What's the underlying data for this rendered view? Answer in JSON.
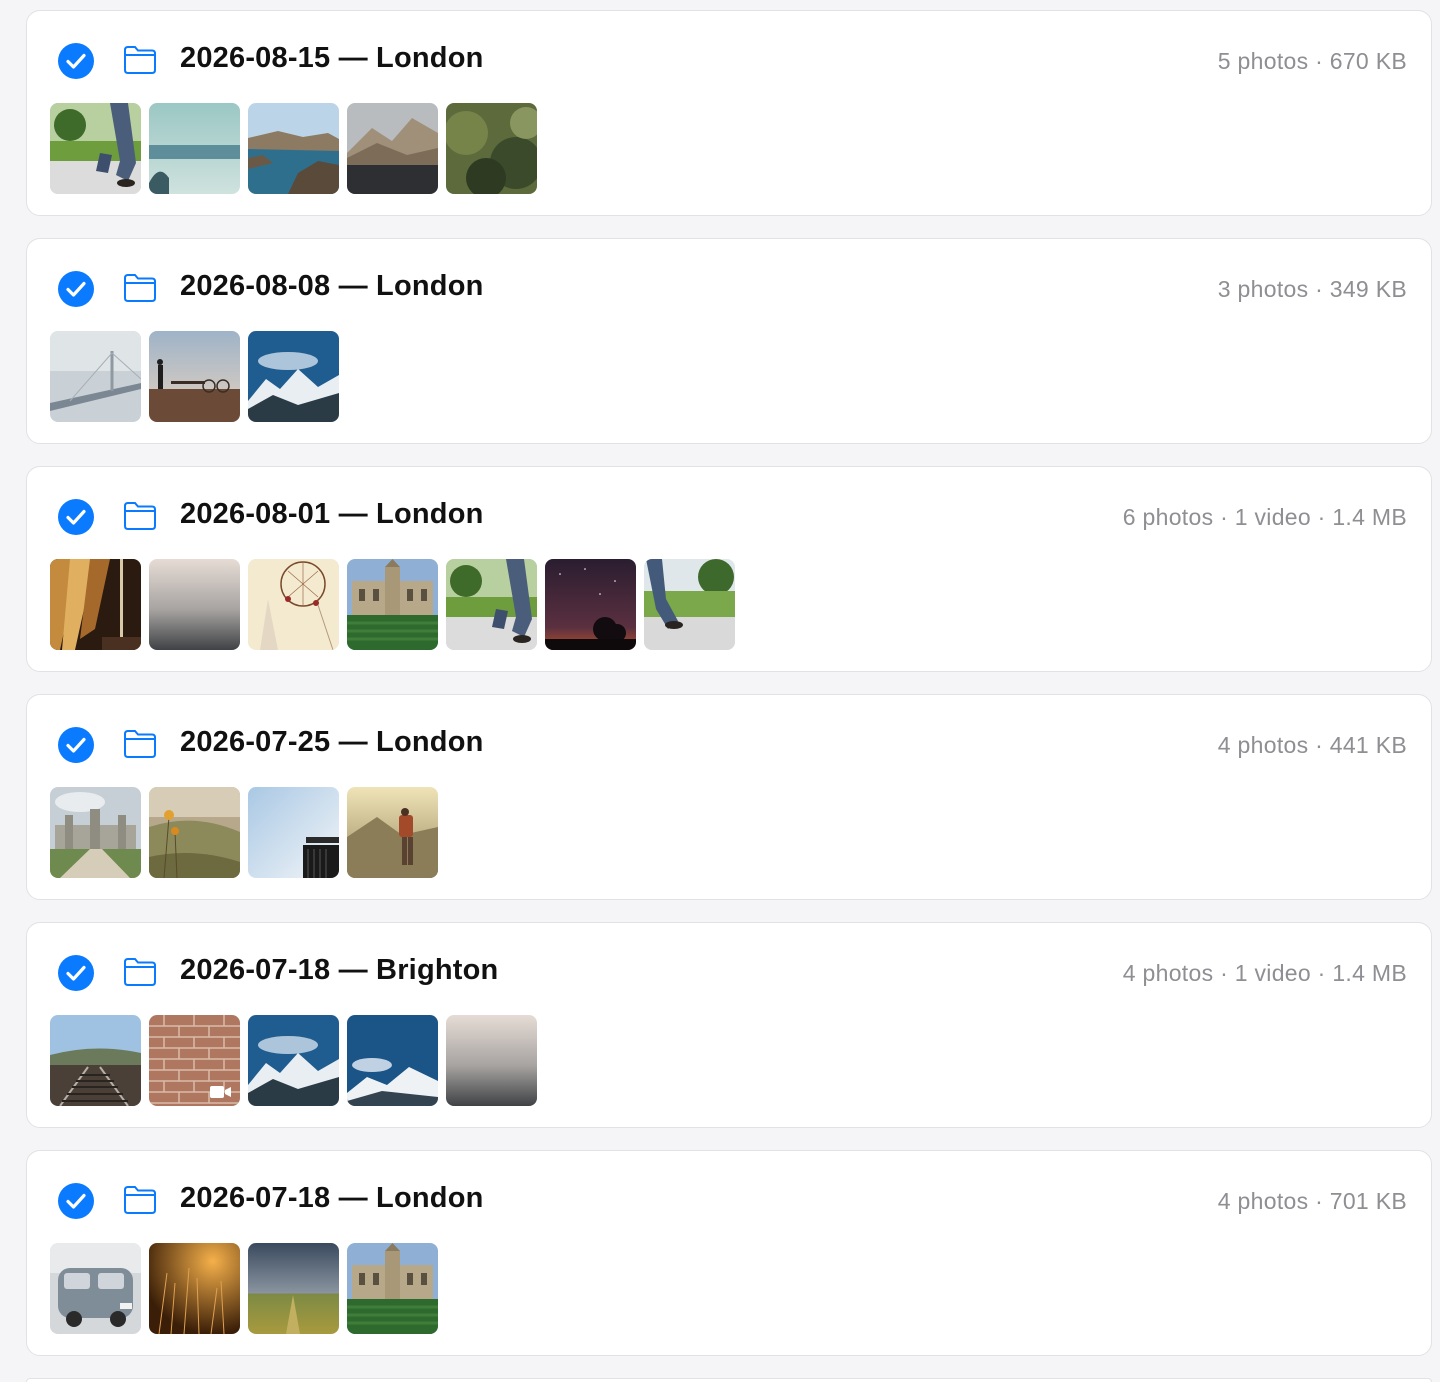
{
  "accent_color": "#0a7aff",
  "folders": [
    {
      "title": "2026-08-15 — London",
      "meta": "5 photos · 670 KB",
      "selected": true,
      "thumbnails": [
        {
          "scene": "park-legs"
        },
        {
          "scene": "teal-ocean"
        },
        {
          "scene": "rocky-coast"
        },
        {
          "scene": "mountain-lake"
        },
        {
          "scene": "dark-forest"
        }
      ]
    },
    {
      "title": "2026-08-08 — London",
      "meta": "3 photos · 349 KB",
      "selected": true,
      "thumbnails": [
        {
          "scene": "foggy-bridge"
        },
        {
          "scene": "person-bicycle-shore"
        },
        {
          "scene": "snowy-mountains"
        }
      ]
    },
    {
      "title": "2026-08-01 — London",
      "meta": "6 photos · 1 video · 1.4 MB",
      "selected": true,
      "thumbnails": [
        {
          "scene": "golden-curtains"
        },
        {
          "scene": "misty-sea"
        },
        {
          "scene": "dreamcatcher"
        },
        {
          "scene": "college-lawn"
        },
        {
          "scene": "park-legs"
        },
        {
          "scene": "night-sky-tree"
        },
        {
          "scene": "park-legs-alt"
        }
      ]
    },
    {
      "title": "2026-07-25 — London",
      "meta": "4 photos · 441 KB",
      "selected": true,
      "thumbnails": [
        {
          "scene": "castle-path"
        },
        {
          "scene": "flowers-valley"
        },
        {
          "scene": "bright-sky-structure"
        },
        {
          "scene": "hiker-mountains"
        }
      ]
    },
    {
      "title": "2026-07-18 — Brighton",
      "meta": "4 photos · 1 video · 1.4 MB",
      "selected": true,
      "thumbnails": [
        {
          "scene": "railway-tracks"
        },
        {
          "scene": "brick-wall",
          "is_video": true
        },
        {
          "scene": "snowy-mountains"
        },
        {
          "scene": "snowy-mountains-alt"
        },
        {
          "scene": "misty-sea"
        }
      ]
    },
    {
      "title": "2026-07-18 — London",
      "meta": "4 photos · 701 KB",
      "selected": true,
      "thumbnails": [
        {
          "scene": "vintage-van"
        },
        {
          "scene": "golden-grass"
        },
        {
          "scene": "stormy-field"
        },
        {
          "scene": "college-lawn"
        }
      ]
    }
  ]
}
